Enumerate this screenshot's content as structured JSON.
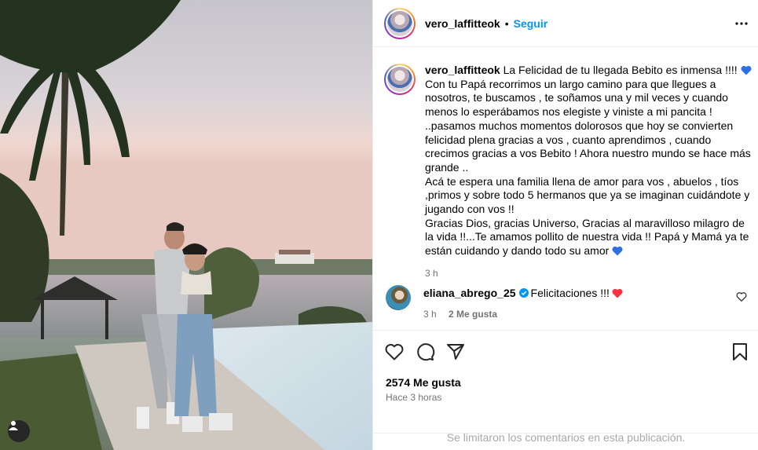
{
  "post": {
    "username": "vero_laffitteok",
    "follow_label": "Seguir",
    "separator": "•",
    "more_icon": "more-horizontal-icon"
  },
  "caption": {
    "username": "vero_laffitteok",
    "lines": [
      "La Felicidad de tu llegada Bebito es inmensa !!!!",
      "Con tu Papá recorrimos un largo camino para que llegues a nosotros, te buscamos , te soñamos una y mil veces y cuando menos lo esperábamos nos elegiste y viniste a mi pancita !",
      "..pasamos muchos momentos dolorosos que hoy se convierten felicidad plena gracias a vos , cuanto aprendimos , cuando crecimos gracias a vos Bebito ! Ahora nuestro mundo se hace más grande ..",
      "Acá te espera una familia llena de amor para vos , abuelos , tíos ,primos y sobre todo 5 hermanos que ya se imaginan cuidándote y jugando con vos !!",
      "Gracias Dios, gracias Universo, Gracias al maravilloso milagro de la vida !!...Te amamos pollito de nuestra vida !! Papá y Mamá ya te están cuidando y dando todo su amor"
    ],
    "time": "3 h",
    "emoji": "blue-heart-icon"
  },
  "comment": {
    "username": "eliana_abrego_25",
    "text": "Felicitaciones !!!",
    "time": "3 h",
    "likes": "2 Me gusta",
    "verified_icon": "verified-badge-icon",
    "emoji": "red-heart-icon"
  },
  "actions": {
    "likes_label": "2574 Me gusta",
    "ago": "Hace 3 horas",
    "comments_limited": "Se limitaron los comentarios en esta publicación."
  },
  "colors": {
    "accent": "#0095f6",
    "muted": "#737373",
    "verified": "#0095f6",
    "heart_red": "#ff3040",
    "heart_blue": "#2f6fe4"
  }
}
